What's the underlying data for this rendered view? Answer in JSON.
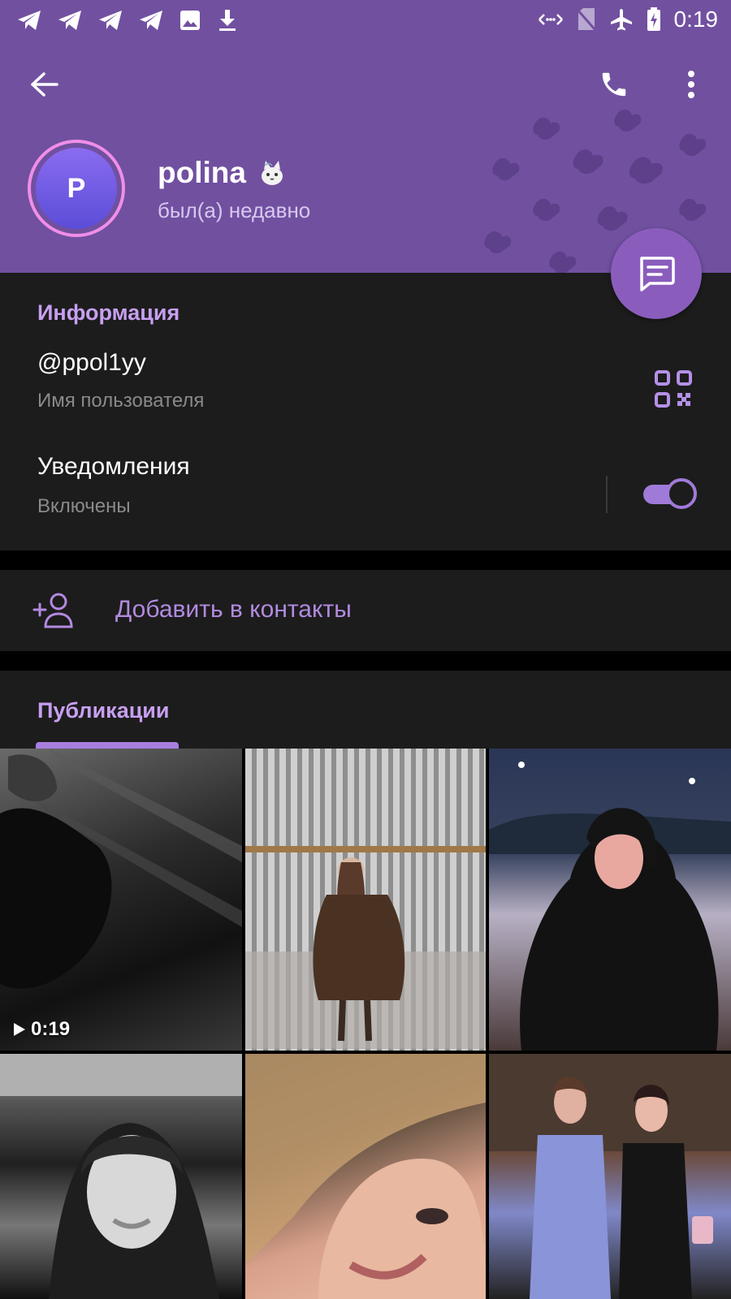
{
  "status_bar": {
    "time": "0:19",
    "icons": [
      "telegram-icon",
      "telegram-icon",
      "telegram-icon",
      "telegram-icon",
      "image-icon",
      "download-icon",
      "data-saver-icon",
      "no-sim-icon",
      "airplane-icon",
      "battery-charging-icon"
    ]
  },
  "colors": {
    "header_bg": "#7150a0",
    "accent": "#c79ff0",
    "surface": "#1c1c1c",
    "background": "#000000"
  },
  "profile": {
    "avatar_letter": "P",
    "name": "polina",
    "emoji_status_icon": "cat-emoji-icon",
    "status": "был(а) недавно"
  },
  "info": {
    "section_title": "Информация",
    "username": "@ppol1yy",
    "username_label": "Имя пользователя",
    "notifications_title": "Уведомления",
    "notifications_value": "Включены",
    "notifications_on": true
  },
  "add_contact": {
    "label": "Добавить в контакты"
  },
  "publications": {
    "tab_label": "Публикации",
    "items": [
      {
        "type": "video",
        "duration": "0:19"
      },
      {
        "type": "photo"
      },
      {
        "type": "photo"
      },
      {
        "type": "photo"
      },
      {
        "type": "photo"
      },
      {
        "type": "photo"
      }
    ]
  }
}
